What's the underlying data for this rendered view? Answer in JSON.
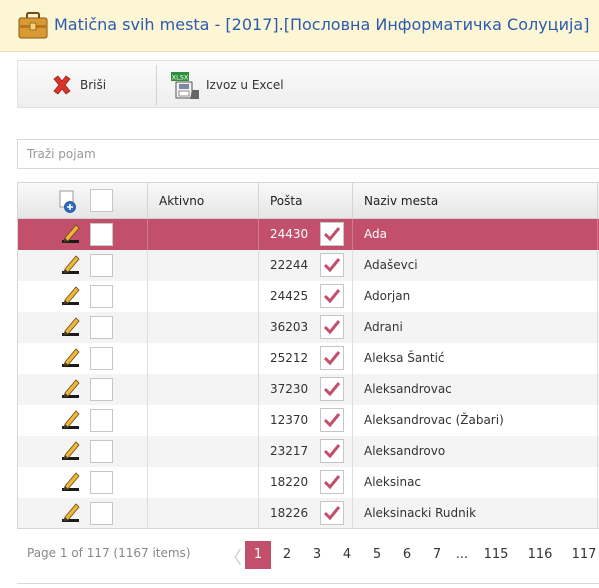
{
  "header": {
    "title": "Matična svih mesta  - [2017].[Пословна Информатичка Солуција]"
  },
  "toolbar": {
    "delete_label": "Briši",
    "export_label": "Izvoz u Excel",
    "export_icon_text": "XLSX"
  },
  "search": {
    "placeholder": "Traži pojam"
  },
  "grid": {
    "columns": [
      "",
      "Aktivno",
      "Pošta",
      "Naziv mesta"
    ],
    "rows": [
      {
        "active": true,
        "posta": "24430",
        "naziv": "Ada",
        "selected": true
      },
      {
        "active": true,
        "posta": "22244",
        "naziv": "Adaševci",
        "selected": false
      },
      {
        "active": true,
        "posta": "24425",
        "naziv": "Adorjan",
        "selected": false
      },
      {
        "active": true,
        "posta": "36203",
        "naziv": "Adrani",
        "selected": false
      },
      {
        "active": true,
        "posta": "25212",
        "naziv": "Aleksa Šantić",
        "selected": false
      },
      {
        "active": true,
        "posta": "37230",
        "naziv": "Aleksandrovac",
        "selected": false
      },
      {
        "active": true,
        "posta": "12370",
        "naziv": "Aleksandrovac (Žabari)",
        "selected": false
      },
      {
        "active": true,
        "posta": "23217",
        "naziv": "Aleksandrovo",
        "selected": false
      },
      {
        "active": true,
        "posta": "18220",
        "naziv": "Aleksinac",
        "selected": false
      },
      {
        "active": true,
        "posta": "18226",
        "naziv": "Aleksinacki Rudnik",
        "selected": false
      }
    ]
  },
  "pager": {
    "info": "Page 1 of 117 (1167 items)",
    "prev_symbol": "〈",
    "pages": [
      "1",
      "2",
      "3",
      "4",
      "5",
      "6",
      "7",
      "...",
      "115",
      "116",
      "117"
    ],
    "current": "1"
  },
  "colors": {
    "accent": "#c2506c",
    "title": "#2a5bb1",
    "titlebar_bg": "#fdf6d4"
  }
}
